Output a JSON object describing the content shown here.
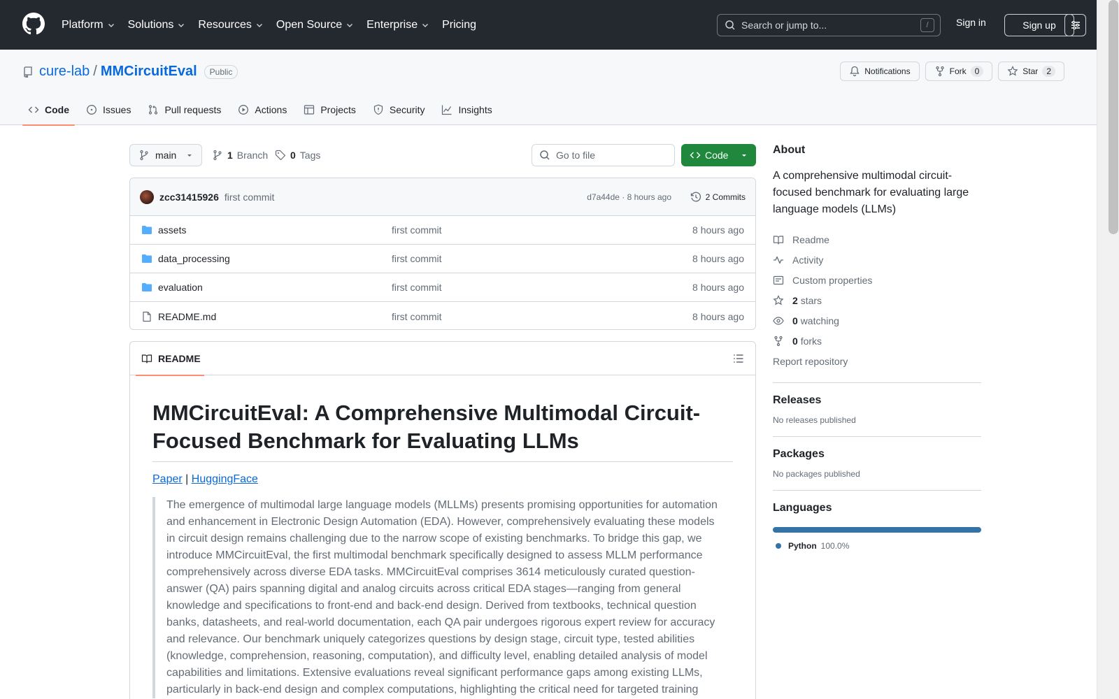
{
  "colors": {
    "header_bg": "#24292f",
    "accent_green": "#1f883d",
    "link_blue": "#0969da",
    "tab_underline": "#fd8c73",
    "python": "#3572A5"
  },
  "topnav": {
    "items": [
      {
        "label": "Platform",
        "has_menu": true
      },
      {
        "label": "Solutions",
        "has_menu": true
      },
      {
        "label": "Resources",
        "has_menu": true
      },
      {
        "label": "Open Source",
        "has_menu": true
      },
      {
        "label": "Enterprise",
        "has_menu": true
      },
      {
        "label": "Pricing",
        "has_menu": false
      }
    ],
    "search_placeholder": "Search or jump to...",
    "search_key": "/",
    "signin": "Sign in",
    "signup": "Sign up"
  },
  "repo": {
    "owner": "cure-lab",
    "separator": "/",
    "name": "MMCircuitEval",
    "visibility": "Public",
    "notifications_label": "Notifications",
    "fork_label": "Fork",
    "fork_count": "0",
    "star_label": "Star",
    "star_count": "2"
  },
  "tabs": [
    {
      "label": "Code",
      "icon": "code-icon",
      "active": true
    },
    {
      "label": "Issues",
      "icon": "issue-icon",
      "active": false
    },
    {
      "label": "Pull requests",
      "icon": "pull-request-icon",
      "active": false
    },
    {
      "label": "Actions",
      "icon": "play-icon",
      "active": false
    },
    {
      "label": "Projects",
      "icon": "table-icon",
      "active": false
    },
    {
      "label": "Security",
      "icon": "shield-icon",
      "active": false
    },
    {
      "label": "Insights",
      "icon": "graph-icon",
      "active": false
    }
  ],
  "branch": {
    "current": "main",
    "branch_count": "1",
    "branch_label": "Branch",
    "tag_count": "0",
    "tag_label": "Tags",
    "goto_placeholder": "Go to file",
    "code_button": "Code"
  },
  "latest_commit": {
    "author": "zcc31415926",
    "message": "first commit",
    "sha_time": "d7a44de · 8 hours ago",
    "commits_label": "2 Commits"
  },
  "files": [
    {
      "name": "assets",
      "type": "folder",
      "message": "first commit",
      "age": "8 hours ago"
    },
    {
      "name": "data_processing",
      "type": "folder",
      "message": "first commit",
      "age": "8 hours ago"
    },
    {
      "name": "evaluation",
      "type": "folder",
      "message": "first commit",
      "age": "8 hours ago"
    },
    {
      "name": "README.md",
      "type": "file",
      "message": "first commit",
      "age": "8 hours ago"
    }
  ],
  "readme": {
    "tab_label": "README",
    "title": "MMCircuitEval: A Comprehensive Multimodal Circuit-Focused Benchmark for Evaluating LLMs",
    "link_paper": "Paper",
    "link_sep": "|",
    "link_hf": "HuggingFace",
    "abstract": "The emergence of multimodal large language models (MLLMs) presents promising opportunities for automation and enhancement in Electronic Design Automation (EDA). However, comprehensively evaluating these models in circuit design remains challenging due to the narrow scope of existing benchmarks. To bridge this gap, we introduce MMCircuitEval, the first multimodal benchmark specifically designed to assess MLLM performance comprehensively across diverse EDA tasks. MMCircuitEval comprises 3614 meticulously curated question-answer (QA) pairs spanning digital and analog circuits across critical EDA stages—ranging from general knowledge and specifications to front-end and back-end design. Derived from textbooks, technical question banks, datasheets, and real-world documentation, each QA pair undergoes rigorous expert review for accuracy and relevance. Our benchmark uniquely categorizes questions by design stage, circuit type, tested abilities (knowledge, comprehension, reasoning, computation), and difficulty level, enabling detailed analysis of model capabilities and limitations. Extensive evaluations reveal significant performance gaps among existing LLMs, particularly in back-end design and complex computations, highlighting the critical need for targeted training"
  },
  "about": {
    "heading": "About",
    "description": "A comprehensive multimodal circuit-focused benchmark for evaluating large language models (LLMs)",
    "readme": "Readme",
    "activity": "Activity",
    "custom_properties": "Custom properties",
    "stars_count": "2",
    "stars_label": "stars",
    "watching_count": "0",
    "watching_label": "watching",
    "forks_count": "0",
    "forks_label": "forks",
    "report": "Report repository"
  },
  "releases": {
    "heading": "Releases",
    "empty": "No releases published"
  },
  "packages": {
    "heading": "Packages",
    "empty": "No packages published"
  },
  "languages": {
    "heading": "Languages",
    "items": [
      {
        "name": "Python",
        "percent": "100.0%",
        "fraction": 1.0,
        "color": "#3572A5"
      }
    ]
  }
}
